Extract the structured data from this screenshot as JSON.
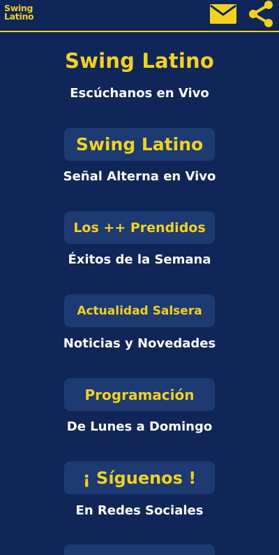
{
  "header": {
    "logo_line1": "Swing",
    "logo_line2": "Latino",
    "mail_icon": "mail-icon",
    "share_icon": "share-icon"
  },
  "hero": {
    "title": "Swing  Latino",
    "subtitle": "Escúchanos en Vivo"
  },
  "items": [
    {
      "label": "Swing Latino",
      "subtitle": "Señal Alterna en Vivo"
    },
    {
      "label": "Los ++ Prendidos",
      "subtitle": "Éxitos de la Semana"
    },
    {
      "label": "Actualidad Salsera",
      "subtitle": "Noticias y Novedades"
    },
    {
      "label": "Programación",
      "subtitle": "De Lunes a Domingo"
    },
    {
      "label": "¡ Síguenos !",
      "subtitle": "En Redes Sociales"
    },
    {
      "label": "",
      "subtitle": ""
    }
  ],
  "colors": {
    "background": "#102659",
    "accent": "#F2D21C",
    "button": "#1D3A72",
    "text": "#FFFFFF"
  }
}
